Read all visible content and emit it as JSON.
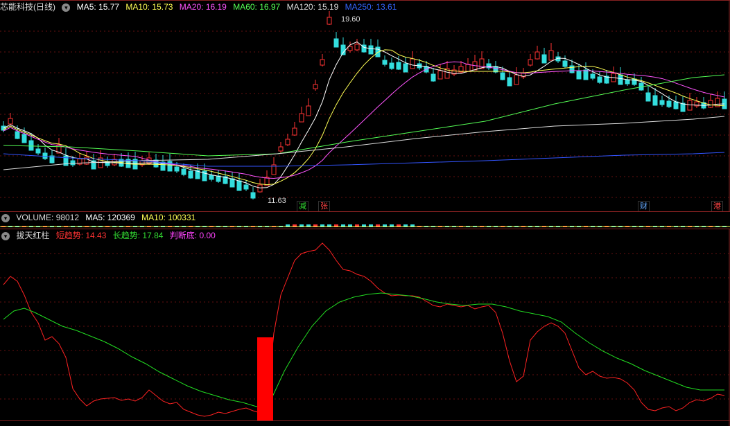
{
  "main": {
    "title": "芯能科技(日线)",
    "ma": [
      {
        "label": "MA5: 15.77",
        "color": "#ffffff"
      },
      {
        "label": "MA10: 15.73",
        "color": "#ffff55"
      },
      {
        "label": "MA20: 16.19",
        "color": "#ff55ff"
      },
      {
        "label": "MA60: 16.97",
        "color": "#55ff55"
      },
      {
        "label": "MA120: 15.19",
        "color": "#dddddd"
      },
      {
        "label": "MA250: 13.61",
        "color": "#3355ff"
      }
    ],
    "high_label": "19.60",
    "low_label": "11.63",
    "events": [
      {
        "text": "减",
        "color": "#33dd33"
      },
      {
        "text": "张",
        "color": "#ff4444"
      },
      {
        "text": "财",
        "color": "#66aaff"
      },
      {
        "text": "港",
        "color": "#ff4444"
      }
    ]
  },
  "volume": {
    "label": "VOLUME: 98012",
    "ma5": "MA5: 120369",
    "ma10": "MA10: 100331"
  },
  "indicator": {
    "name": "拔天红柱",
    "short": "短趋势: 14.43",
    "long": "长趋势: 17.84",
    "judge": "判断底: 0.00"
  },
  "colors": {
    "up": "#ff3333",
    "down": "#33dddd",
    "ma5": "#ffffff",
    "ma10": "#ffff55",
    "ma20": "#ff55ff",
    "ma60": "#55ff55",
    "ma120": "#dddddd",
    "ma250": "#3355ff",
    "short": "#ff2222",
    "long": "#22dd22",
    "bar": "#ff0000"
  }
}
